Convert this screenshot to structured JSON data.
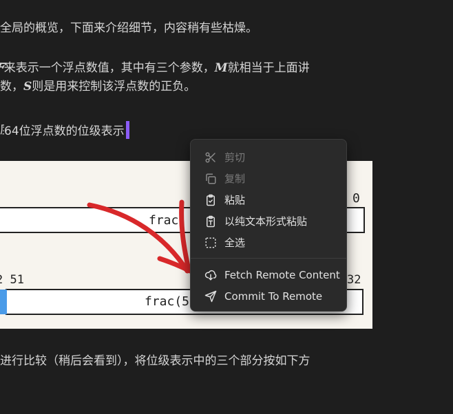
{
  "document": {
    "line1": "全局的概览，下面来介绍细节，内容稍有些枯燥。",
    "line2": "来表示一个浮点数值，其中有三个参数，",
    "line2_m": "M",
    "line2_tail": "就相当于上面讲",
    "line3_pre": "数，",
    "line3_s": "S",
    "line3_tail": "则是用来控制该浮点数的正负。",
    "line4": "64位浮点数的位级表示",
    "line5": "进行比较（稍后会看到），将位级表示中的三个部分按如下方"
  },
  "figure": {
    "top_label_0": "0",
    "top_frac": "frac",
    "bottom_left_label": "2 51",
    "bottom_right_label": "32",
    "bottom_frac": "frac(5"
  },
  "context_menu": {
    "items": [
      {
        "label": "剪切",
        "icon": "scissors-icon",
        "enabled": false
      },
      {
        "label": "复制",
        "icon": "copy-icon",
        "enabled": false
      },
      {
        "label": "粘贴",
        "icon": "clipboard-check-icon",
        "enabled": true
      },
      {
        "label": "以纯文本形式粘贴",
        "icon": "clipboard-text-icon",
        "enabled": true
      },
      {
        "label": "全选",
        "icon": "select-all-icon",
        "enabled": true
      },
      {
        "label": "Fetch Remote Content",
        "icon": "cloud-download-icon",
        "enabled": true
      },
      {
        "label": "Commit To Remote",
        "icon": "send-icon",
        "enabled": true
      }
    ]
  },
  "colors": {
    "background": "#1e1e1e",
    "caret": "#8b5cf6",
    "annotation_arrow": "#d8282a",
    "menu_bg": "#2a2a2a"
  }
}
